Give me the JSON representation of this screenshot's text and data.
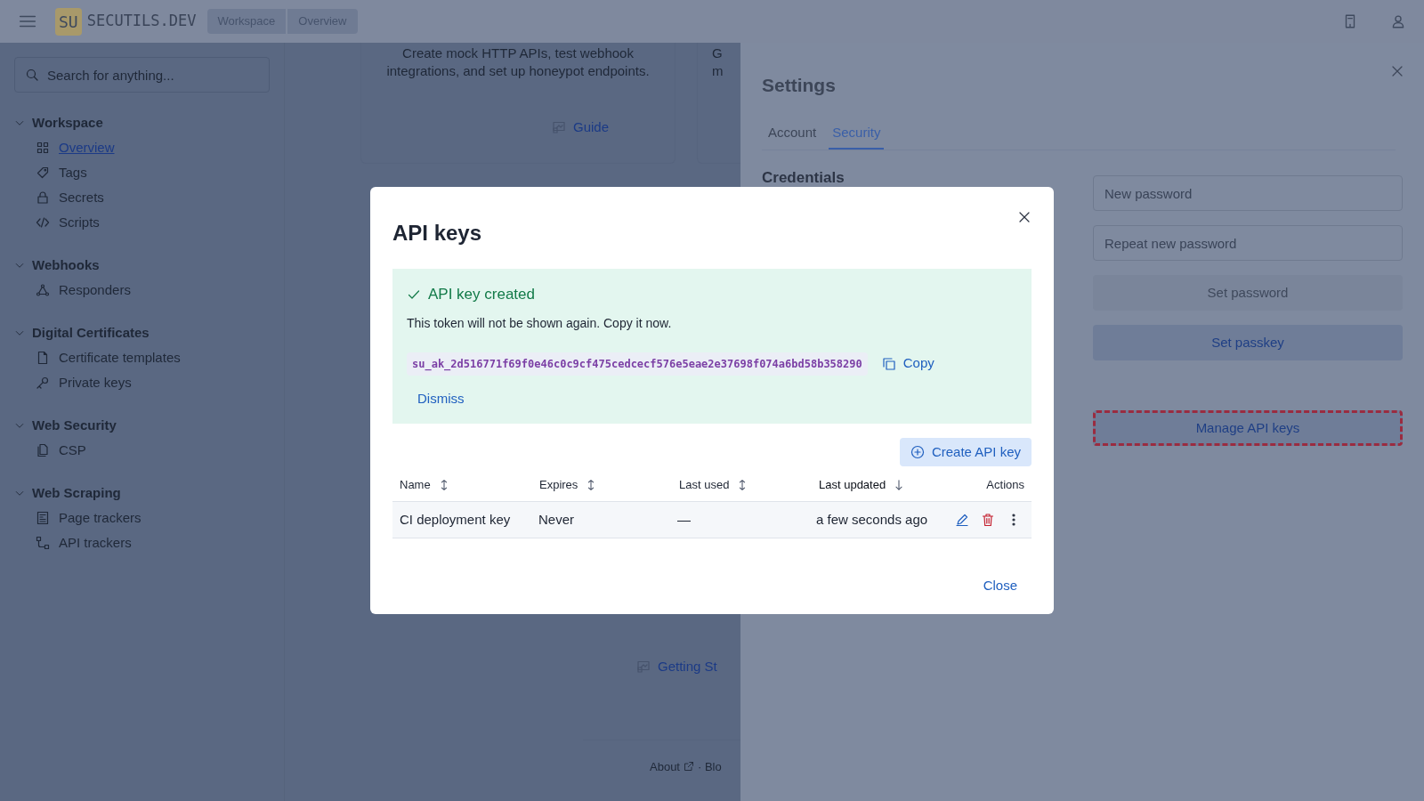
{
  "top_bar": {
    "logo_badge": "SU",
    "logo_text": "SECUTILS.DEV",
    "breadcrumbs": [
      "Workspace",
      "Overview"
    ]
  },
  "sidebar": {
    "search": {
      "placeholder": "Search for anything..."
    },
    "sections": [
      {
        "title": "Workspace",
        "expanded": true,
        "items": [
          {
            "label": "Overview",
            "selected": true
          },
          {
            "label": "Tags",
            "selected": false
          },
          {
            "label": "Secrets",
            "selected": false
          },
          {
            "label": "Scripts",
            "selected": false
          }
        ]
      },
      {
        "title": "Webhooks",
        "expanded": true,
        "items": [
          {
            "label": "Responders",
            "selected": false
          }
        ]
      },
      {
        "title": "Digital Certificates",
        "expanded": true,
        "items": [
          {
            "label": "Certificate templates",
            "selected": false
          },
          {
            "label": "Private keys",
            "selected": false
          }
        ]
      },
      {
        "title": "Web Security",
        "expanded": true,
        "items": [
          {
            "label": "CSP",
            "selected": false
          }
        ]
      },
      {
        "title": "Web Scraping",
        "expanded": true,
        "items": [
          {
            "label": "Page trackers",
            "selected": false
          },
          {
            "label": "API trackers",
            "selected": false
          }
        ]
      }
    ]
  },
  "main": {
    "cards": [
      {
        "lines": [
          "Create mock HTTP APIs, test webhook",
          "integrations, and set up honeypot endpoints."
        ],
        "link": "Guide"
      },
      {
        "lines": [
          "G",
          "m"
        ]
      }
    ],
    "getting_started_link": "Getting St",
    "footer": {
      "link": "About",
      "rest": "· Blo"
    }
  },
  "settings": {
    "title": "Settings",
    "tabs": [
      {
        "label": "Account",
        "selected": false
      },
      {
        "label": "Security",
        "selected": true
      }
    ],
    "section_title": "Credentials",
    "fields": [
      {
        "placeholder": "New password"
      },
      {
        "placeholder": "Repeat new password"
      }
    ],
    "buttons": [
      {
        "label": "Set password",
        "disabled": true,
        "highlighted": false
      },
      {
        "label": "Set passkey",
        "disabled": false,
        "highlighted": false
      },
      {
        "label": "Manage API keys",
        "disabled": false,
        "highlighted": true
      }
    ]
  },
  "dialog": {
    "title": "API keys",
    "alert": {
      "title": "API key created",
      "message": "This token will not be shown again. Copy it now.",
      "token": "su_ak_2d516771f69f0e46c0c9cf475cedcecf576e5eae2e37698f074a6bd58b358290",
      "copy_label": "Copy",
      "dismiss_label": "Dismiss"
    },
    "create_button": "Create API key",
    "columns": [
      {
        "label": "Name",
        "sortable": true,
        "sorted": false
      },
      {
        "label": "Expires",
        "sortable": true,
        "sorted": false
      },
      {
        "label": "Last used",
        "sortable": true,
        "sorted": false
      },
      {
        "label": "Last updated",
        "sortable": true,
        "sorted": true
      },
      {
        "label": "Actions"
      }
    ],
    "rows": [
      {
        "cells": [
          "CI deployment key",
          "Never",
          "—",
          "a few seconds ago"
        ]
      }
    ],
    "close_button": "Close"
  }
}
